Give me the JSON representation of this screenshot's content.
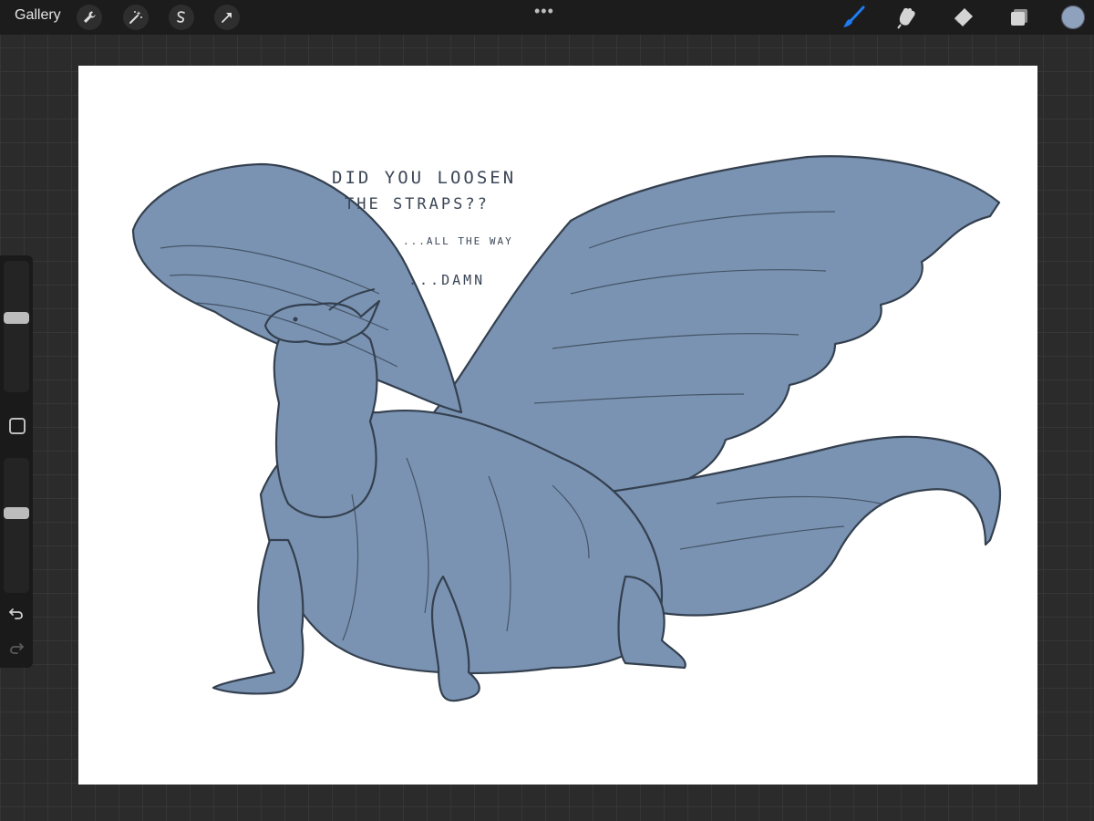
{
  "topbar": {
    "gallery_label": "Gallery",
    "left_tools": [
      {
        "name": "wrench-icon"
      },
      {
        "name": "magic-wand-icon"
      },
      {
        "name": "selection-icon"
      },
      {
        "name": "transform-arrow-icon"
      }
    ],
    "more_label": "•••",
    "right_tools": [
      {
        "name": "brush-icon",
        "active": true
      },
      {
        "name": "smudge-icon",
        "active": false
      },
      {
        "name": "eraser-icon",
        "active": false
      },
      {
        "name": "layers-icon",
        "active": false
      }
    ],
    "active_color": "#8fa2bd",
    "accent_color": "#1e7cf2"
  },
  "canvas": {
    "note_line1": "DID YOU LOOSEN",
    "note_line2": "THE STRAPS??",
    "note_line3": "...ALL THE WAY",
    "note_line4": "...DAMN",
    "dragon_fill": "#7a93b2",
    "line_color": "#34404f"
  },
  "sidebar": {
    "brush_size_level": 0.57,
    "opacity_level": 0.6
  }
}
